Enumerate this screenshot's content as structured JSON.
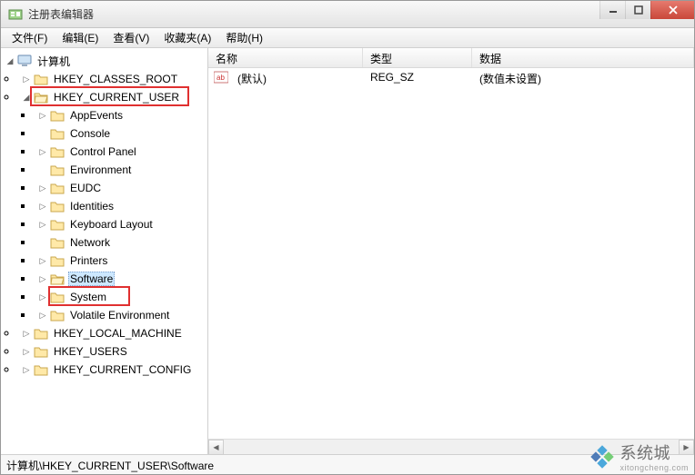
{
  "window": {
    "title": "注册表编辑器"
  },
  "menu": {
    "file": "文件(F)",
    "edit": "编辑(E)",
    "view": "查看(V)",
    "favorites": "收藏夹(A)",
    "help": "帮助(H)"
  },
  "columns": {
    "name": "名称",
    "type": "类型",
    "data": "数据"
  },
  "values": {
    "default": {
      "name": "(默认)",
      "type": "REG_SZ",
      "data": "(数值未设置)"
    }
  },
  "tree": {
    "root": "计算机",
    "hkcr": "HKEY_CLASSES_ROOT",
    "hkcu": "HKEY_CURRENT_USER",
    "hkcu_children": {
      "appevents": "AppEvents",
      "console": "Console",
      "controlpanel": "Control Panel",
      "environment": "Environment",
      "eudc": "EUDC",
      "identities": "Identities",
      "keyboard": "Keyboard Layout",
      "network": "Network",
      "printers": "Printers",
      "software": "Software",
      "system": "System",
      "volatile": "Volatile Environment"
    },
    "hklm": "HKEY_LOCAL_MACHINE",
    "hku": "HKEY_USERS",
    "hkcc": "HKEY_CURRENT_CONFIG"
  },
  "statusbar": {
    "path": "计算机\\HKEY_CURRENT_USER\\Software"
  },
  "watermark": {
    "text": "系统城",
    "sub": "xitongcheng.com"
  }
}
